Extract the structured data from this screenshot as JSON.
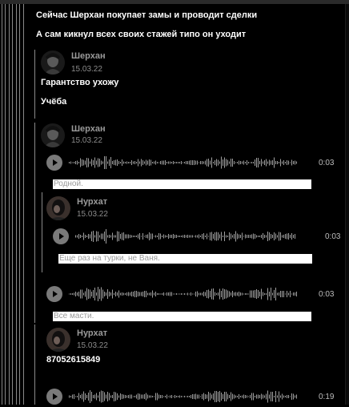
{
  "messages": {
    "line1": "Сейчас Шерхан покупает замы и проводит сделки",
    "line2": "А сам кикнул всех своих стажей типо он уходит"
  },
  "forward1": {
    "author": "Шерхан",
    "date": "15.03.22",
    "text1": "Гарантство ухожу",
    "text2": "Учёба"
  },
  "forward2": {
    "author": "Шерхан",
    "date": "15.03.22",
    "voice1_duration": "0:03",
    "voice1_caption": "Родной.",
    "voice3_duration": "0:03",
    "voice3_caption": "Все масти."
  },
  "nested": {
    "author": "Нурхат",
    "date": "15.03.22",
    "voice2_duration": "0:03",
    "voice2_caption": "Еще раз на турки, не Ваня."
  },
  "forward3": {
    "author": "Нурхат",
    "date": "15.03.22",
    "text": "87052615849",
    "voice4_duration": "0:19"
  },
  "colors": {
    "background": "#000000",
    "text": "#ffffff",
    "author": "#9a9a9a",
    "play_button": "#7a7a7a",
    "waveform": "#a0a0a0"
  },
  "icons": [
    "play-icon",
    "waveform-icon",
    "avatar-sherkhan",
    "avatar-nurkhat"
  ]
}
